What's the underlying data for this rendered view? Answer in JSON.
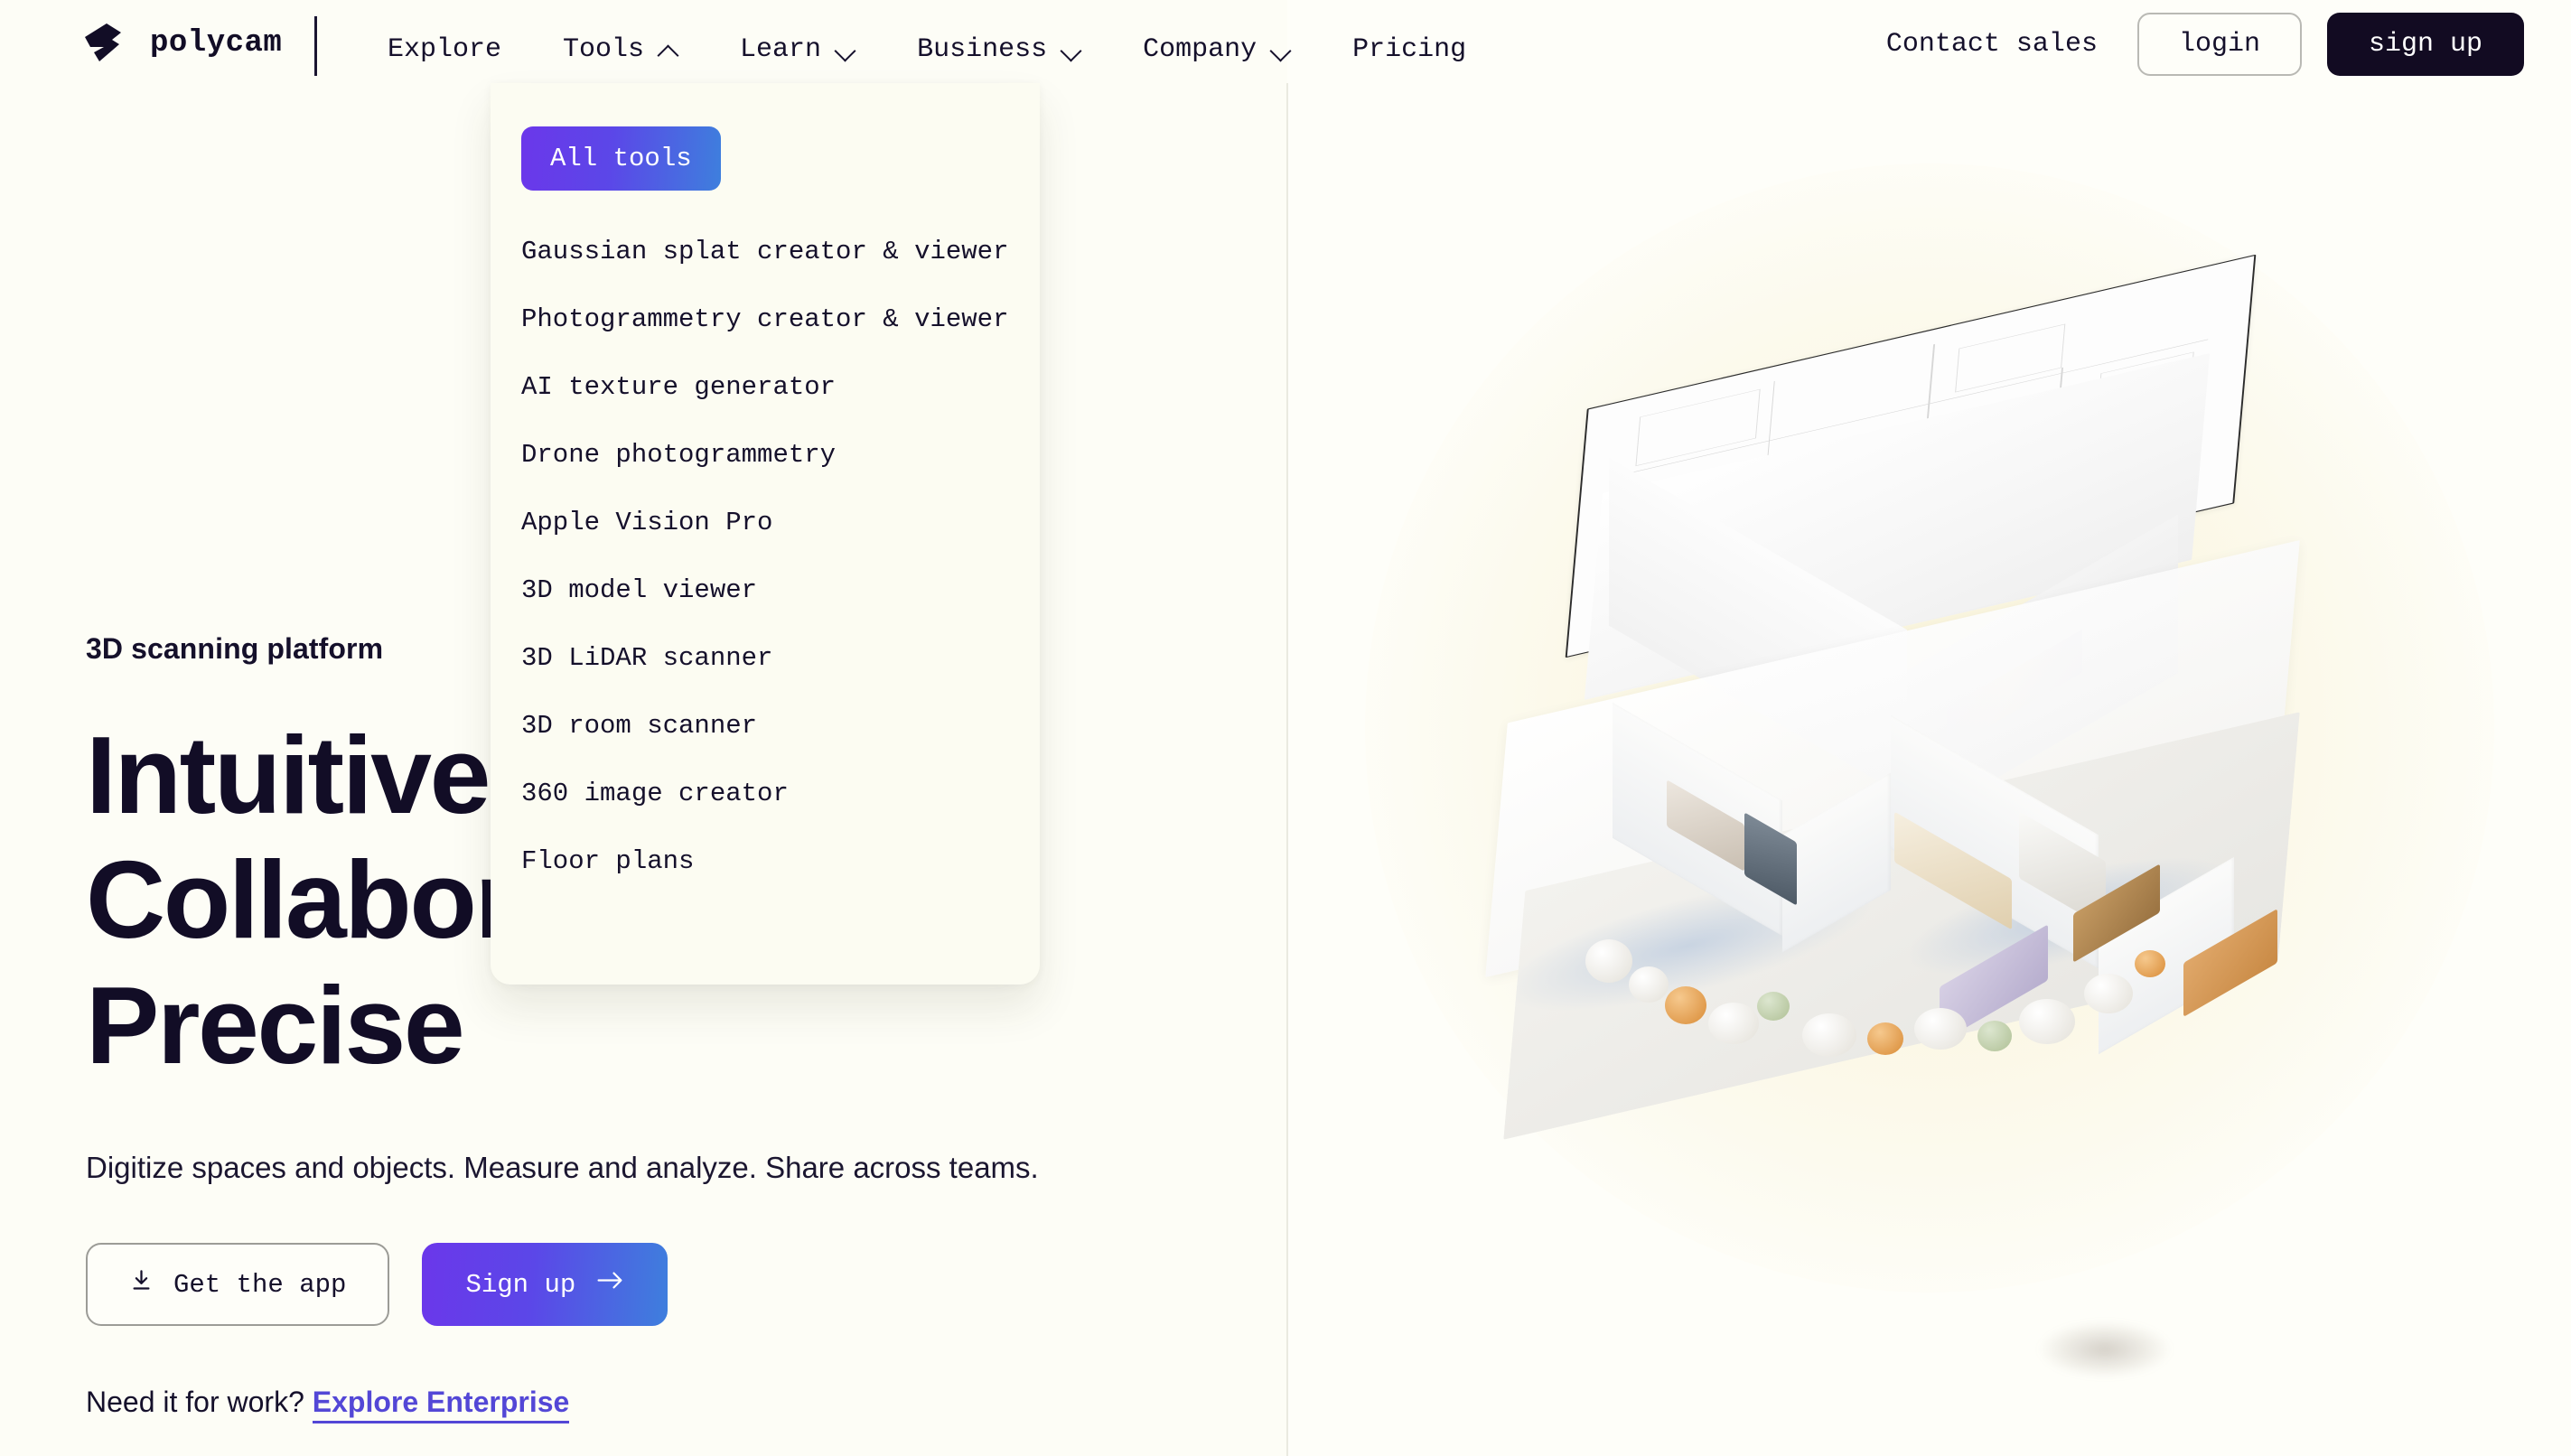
{
  "brand": {
    "name": "polycam",
    "logo_icon": "polycam-logo-mark"
  },
  "nav": {
    "items": [
      {
        "label": "Explore",
        "chevron": null
      },
      {
        "label": "Tools",
        "chevron": "chevron-up"
      },
      {
        "label": "Learn",
        "chevron": "chevron-down"
      },
      {
        "label": "Business",
        "chevron": "chevron-down"
      },
      {
        "label": "Company",
        "chevron": "chevron-down"
      },
      {
        "label": "Pricing",
        "chevron": null
      }
    ]
  },
  "header_actions": {
    "contact_sales": "Contact sales",
    "login": "login",
    "signup": "sign up"
  },
  "tools_dropdown": {
    "open": true,
    "all_tools_label": "All tools",
    "items": [
      "Gaussian splat creator & viewer",
      "Photogrammetry creator & viewer",
      "AI texture generator",
      "Drone photogrammetry",
      "Apple Vision Pro",
      "3D model viewer",
      "3D LiDAR scanner",
      "3D room scanner",
      "360 image creator",
      "Floor plans"
    ]
  },
  "hero": {
    "eyebrow": "3D scanning platform",
    "headline_lines": [
      "Intuitive",
      "Collaborative",
      "Precise"
    ],
    "subhead": "Digitize spaces and objects. Measure and analyze. Share across teams.",
    "cta_primary": "Sign up",
    "cta_primary_icon": "arrow-right-icon",
    "cta_secondary": "Get the app",
    "cta_secondary_icon": "download-icon",
    "work_prefix": "Need it for work?",
    "work_link": "Explore Enterprise"
  },
  "illustration": {
    "alt": "exploded 3D house scan: floor plan layer, white massing volume, textured photogrammetry interior"
  },
  "colors": {
    "page_bg": "#FEFEF9",
    "dropdown_bg": "#FCFCF2",
    "text_dark": "#120D26",
    "accent_purple": "#6B37EA",
    "accent_blue": "#3E7FDD",
    "enterprise_link": "#5347D6",
    "signup_dark": "#120B22",
    "glow_cream": "#FAF5DC"
  }
}
